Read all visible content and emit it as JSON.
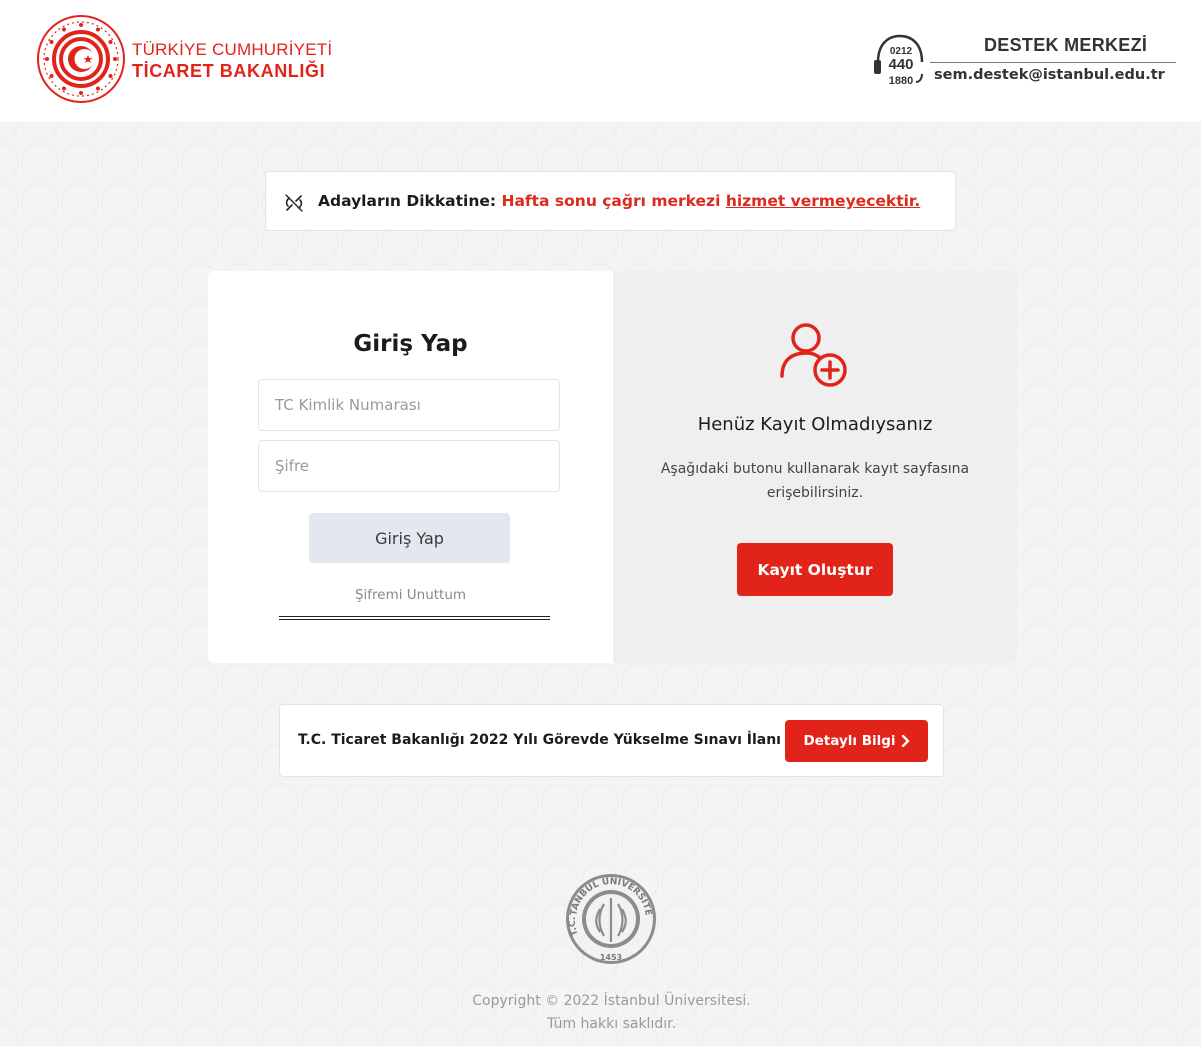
{
  "header": {
    "logo": {
      "line1": "TÜRKİYE CUMHURİYETİ",
      "line2": "TİCARET BAKANLIĞI"
    },
    "support": {
      "badge_top": "0212",
      "badge_mid": "440",
      "badge_bottom": "1880",
      "title": "DESTEK MERKEZİ",
      "email": "sem.destek@istanbul.edu.tr"
    }
  },
  "notice": {
    "icon": "broken-link-icon",
    "label": "Adayların Dikkatine:",
    "highlight": "Hafta sonu çağrı merkezi",
    "link": "hizmet vermeyecektir."
  },
  "login": {
    "title": "Giriş Yap",
    "tc_placeholder": "TC Kimlik Numarası",
    "password_placeholder": "Şifre",
    "submit_label": "Giriş Yap",
    "forgot_label": "Şifremi Unuttum"
  },
  "register": {
    "icon": "add-user-icon",
    "title": "Henüz Kayıt Olmadıysanız",
    "desc_line1": "Aşağıdaki butonu kullanarak kayıt sayfasına",
    "desc_line2": "erişebilirsiniz.",
    "button_label": "Kayıt Oluştur"
  },
  "announcement": {
    "text": "T.C. Ticaret Bakanlığı 2022 Yılı Görevde Yükselme Sınavı İlanı",
    "button_label": "Detaylı Bilgi",
    "button_icon": "chevron-right-icon"
  },
  "footer": {
    "seal_text": "İSTANBUL ÜNİVERSİTESİ",
    "seal_prefix": "T.C.",
    "seal_year": "1453",
    "copyright_line1": "Copyright © 2022 İstanbul Üniversitesi.",
    "copyright_line2": "Tüm hakkı saklıdır."
  },
  "colors": {
    "brand_red": "#e2231a",
    "notice_red": "#dd2a1d",
    "background": "#f4f4f4",
    "login_button_bg": "#e4e7ef",
    "register_panel_bg": "#efeff0"
  }
}
